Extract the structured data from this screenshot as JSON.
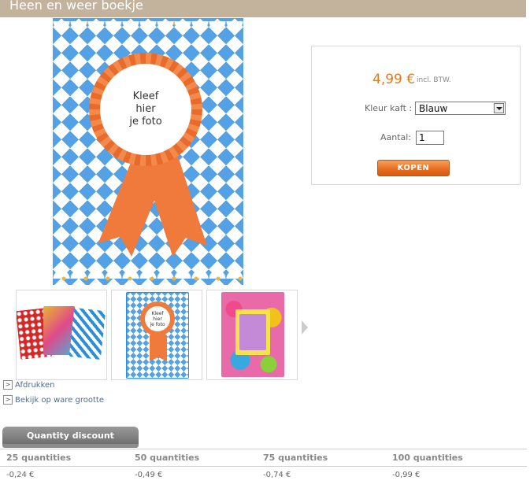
{
  "page": {
    "title": "Heen en weer boekje"
  },
  "product_image": {
    "caption_lines": [
      "Kleef",
      "hier",
      "je foto"
    ]
  },
  "thumbnail_caption": [
    "Kleef",
    "hier",
    "je foto"
  ],
  "links": {
    "print": "Afdrukken",
    "full_size": "Bekijk op ware grootte"
  },
  "buy": {
    "price": "4,99 €",
    "price_note": "incl. BTW.",
    "color_label": "Kleur kaft :",
    "color_value": "Blauw",
    "qty_label": "Aantal:",
    "qty_value": "1",
    "button": "KOPEN"
  },
  "discount": {
    "tab": "Quantity discount",
    "headers": [
      "25 quantities",
      "50 quantities",
      "75 quantities",
      "100 quantities"
    ],
    "values": [
      "-0,24 €",
      "-0,49 €",
      "-0,74 €",
      "-0,99 €"
    ]
  },
  "colors": {
    "title_bar": "#c4b39c",
    "accent": "#e07a25",
    "check_blue": "#1a82dc",
    "rosette": "#f07a3c"
  },
  "icons": {
    "link_marker": "chevron-right-icon",
    "next": "arrow-right-icon"
  }
}
